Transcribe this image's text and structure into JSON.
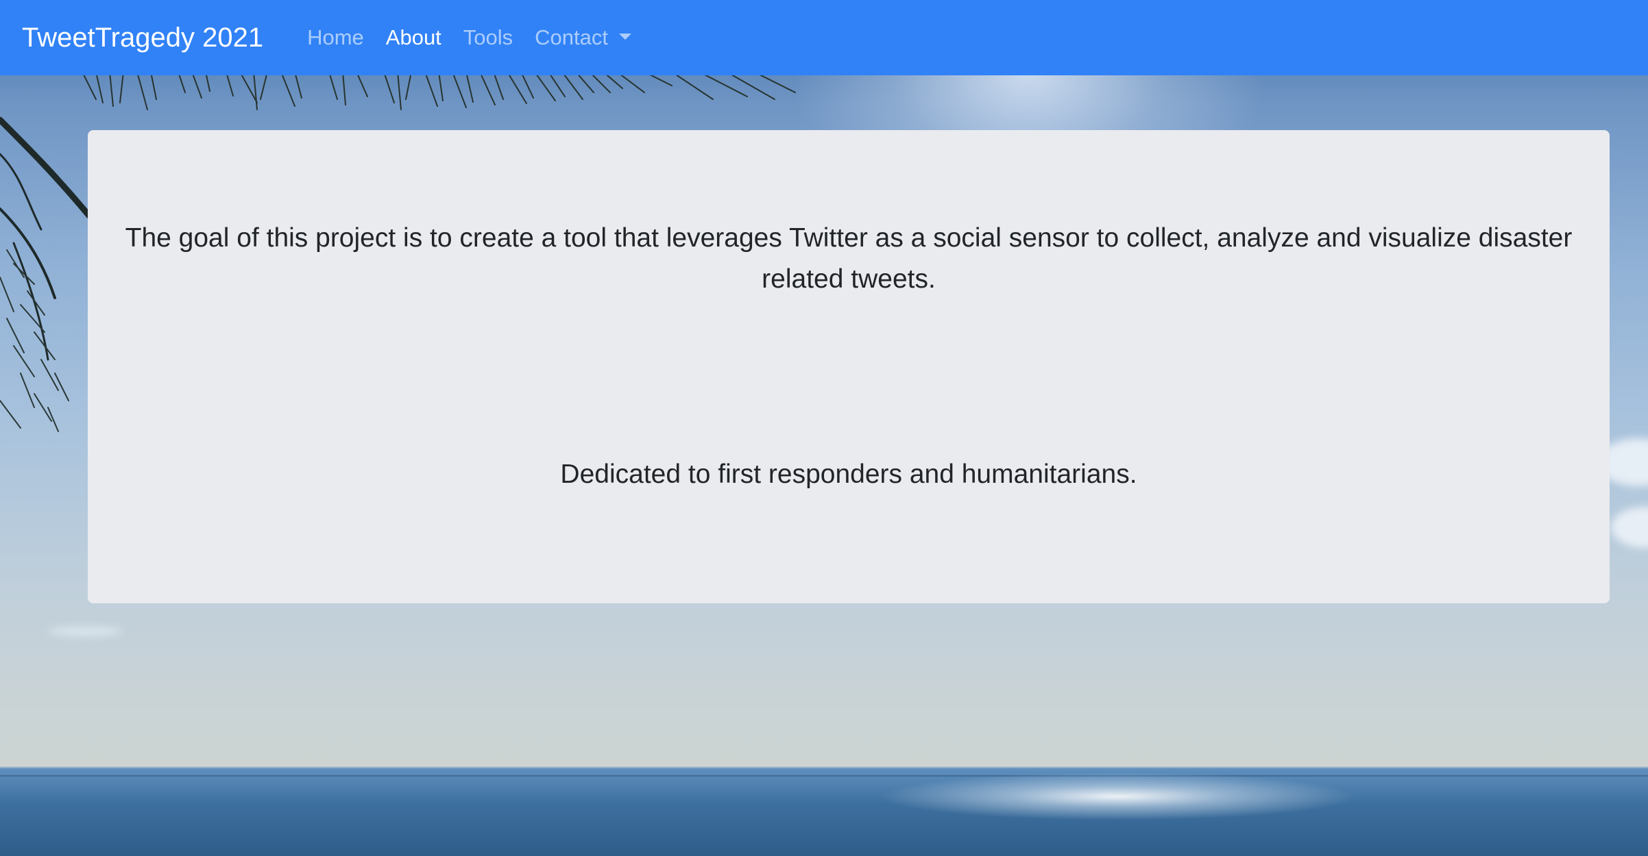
{
  "navbar": {
    "brand": "TweetTragedy 2021",
    "links": [
      {
        "label": "Home",
        "active": false
      },
      {
        "label": "About",
        "active": true
      },
      {
        "label": "Tools",
        "active": false
      },
      {
        "label": "Contact",
        "active": false,
        "dropdown": true
      }
    ],
    "background_color": "#3182f6"
  },
  "content": {
    "goal_text": "The goal of this project is to create a tool that leverages Twitter as a social sensor to collect, analyze and visualize disaster related tweets.",
    "dedication_text": "Dedicated to first responders and humanitarians.",
    "card_color": "#eaebef"
  },
  "background": {
    "scene": "beach-sky-sea-with-tree-branches"
  }
}
